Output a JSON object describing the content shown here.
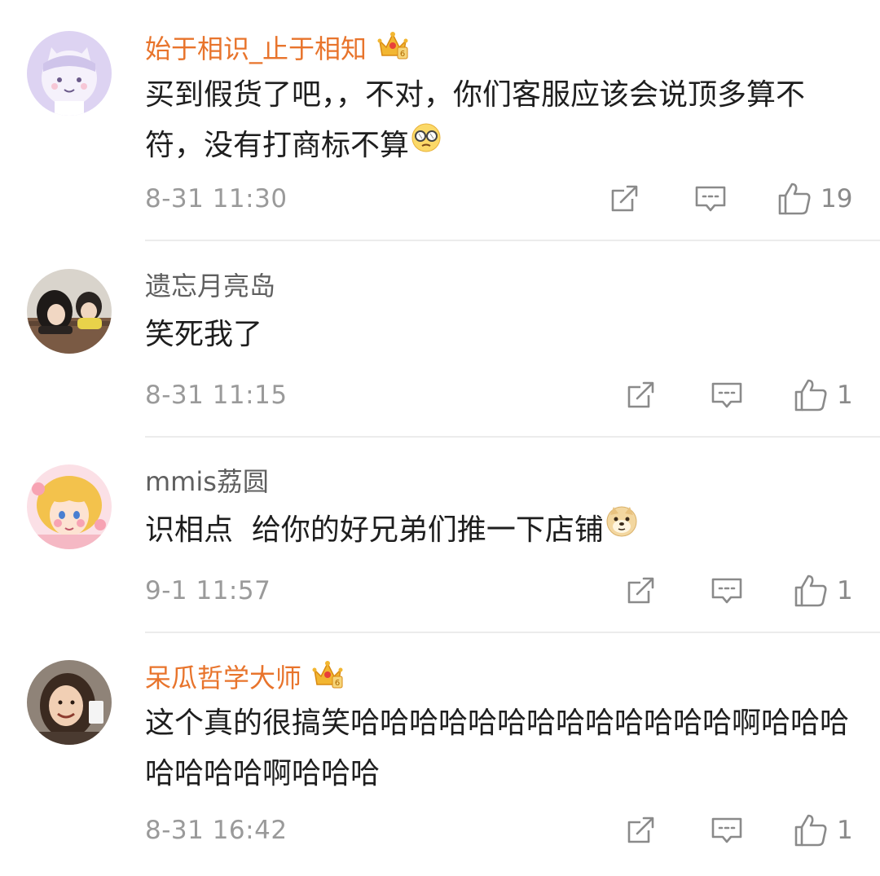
{
  "comments": [
    {
      "username": "始于相识_止于相知",
      "text": "买到假货了吧，，不对，你们客服应该会说顶多算不符，没有打商标不算",
      "emoji_icon": "broken-glasses-emoji",
      "time": "8-31 11:30",
      "likes": "19",
      "vip": true
    },
    {
      "username": "遗忘月亮岛",
      "text": "笑死我了",
      "time": "8-31 11:15",
      "likes": "1",
      "vip": false
    },
    {
      "username": "mmis荔圆",
      "text": "识相点  给你的好兄弟们推一下店铺",
      "emoji_icon": "doge-emoji",
      "time": "9-1 11:57",
      "likes": "1",
      "vip": false
    },
    {
      "username": "呆瓜哲学大师",
      "text": "这个真的很搞笑哈哈哈哈哈哈哈哈哈哈哈哈哈啊哈哈哈哈哈哈哈啊哈哈哈",
      "time": "8-31 16:42",
      "likes": "1",
      "vip": true
    }
  ],
  "colors": {
    "vip_name": "#e8742c",
    "normal_name": "#5f5f5f",
    "meta_gray": "#9a9a9a",
    "icon_gray": "#8a8a8a",
    "divider": "#ececec"
  },
  "icons": {
    "repost": "repost-icon",
    "comment": "comment-icon",
    "like": "thumbs-up-icon",
    "crown": "vip-crown-icon"
  }
}
